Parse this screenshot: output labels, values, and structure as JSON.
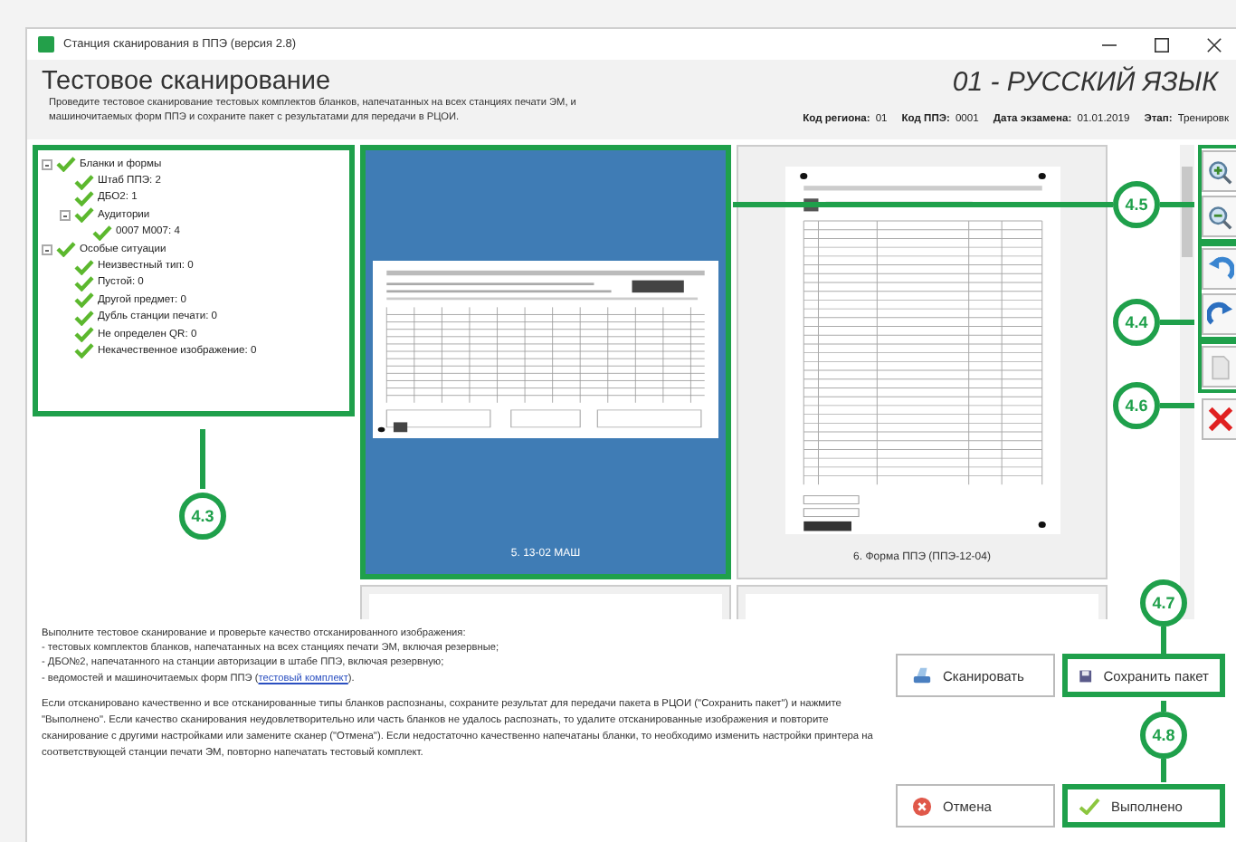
{
  "window": {
    "title": "Станция сканирования в ППЭ (версия 2.8)"
  },
  "header": {
    "title": "Тестовое сканирование",
    "description": "Проведите тестовое сканирование тестовых комплектов бланков, напечатанных на всех станциях печати ЭМ, и машиночитаемых форм ППЭ и сохраните пакет с результатами для передачи в РЦОИ.",
    "subject": "01 - РУССКИЙ ЯЗЫК",
    "fields": [
      {
        "label": "Код региона:",
        "value": "01"
      },
      {
        "label": "Код ППЭ:",
        "value": "0001"
      },
      {
        "label": "Дата экзамена:",
        "value": "01.01.2019"
      },
      {
        "label": "Этап:",
        "value": "Тренировк"
      }
    ]
  },
  "tree": {
    "highlighted": true,
    "items": [
      {
        "label": "Бланки и формы",
        "checked": true,
        "expanded": true,
        "children": [
          {
            "label": "Штаб ППЭ: 2",
            "checked": true
          },
          {
            "label": "ДБО2: 1",
            "checked": true
          },
          {
            "label": "Аудитории",
            "checked": true,
            "expanded": true,
            "children": [
              {
                "label": "0007 М007: 4",
                "checked": true
              }
            ]
          }
        ]
      },
      {
        "label": "Особые ситуации",
        "checked": true,
        "expanded": true,
        "children": [
          {
            "label": "Неизвестный тип: 0",
            "checked": true
          },
          {
            "label": "Пустой: 0",
            "checked": true
          },
          {
            "label": "Другой предмет: 0",
            "checked": true
          },
          {
            "label": "Дубль станции печати: 0",
            "checked": true
          },
          {
            "label": "Не определен QR: 0",
            "checked": true
          },
          {
            "label": "Некачественное изображение: 0",
            "checked": true
          }
        ]
      }
    ]
  },
  "thumbnails": [
    {
      "caption": "5. 13-02 МАШ",
      "selected": true,
      "highlighted": true,
      "kind": "landscape"
    },
    {
      "caption": "6. Форма ППЭ (ППЭ-12-04)",
      "selected": false,
      "highlighted": false,
      "kind": "portrait"
    },
    {
      "selected": false,
      "highlighted": false,
      "kind": "partial"
    },
    {
      "selected": false,
      "highlighted": false,
      "kind": "partial"
    }
  ],
  "toolbar": [
    {
      "highlighted": true,
      "buttons": [
        {
          "kind": "zoom-in"
        },
        {
          "kind": "zoom-out"
        }
      ]
    },
    {
      "highlighted": true,
      "buttons": [
        {
          "kind": "rotate-left"
        },
        {
          "kind": "rotate-right"
        }
      ]
    },
    {
      "highlighted": true,
      "buttons": [
        {
          "kind": "page"
        }
      ]
    },
    {
      "highlighted": false,
      "buttons": [
        {
          "kind": "delete"
        }
      ]
    }
  ],
  "instructions": {
    "lines": [
      "Выполните тестовое сканирование и проверьте качество отсканированного изображения:",
      "- тестовых комплектов бланков, напечатанных на всех станциях печати ЭМ, включая резервные;",
      "- ДБО№2, напечатанного на станции авторизации в штабе ППЭ, включая резервную;"
    ],
    "last_line": {
      "text": "- ведомостей и машиночитаемых форм ППЭ (",
      "link": "тестовый комплект",
      "after": ")."
    },
    "paragraph": "Если отсканировано качественно и все отсканированные типы бланков распознаны, сохраните результат для передачи пакета в РЦОИ (\"Сохранить пакет\") и нажмите \"Выполнено\". Если качество сканирования неудовлетворительно или часть бланков не удалось распознать, то удалите отсканированные изображения и повторите сканирование с другими настройками или замените сканер (\"Отмена\"). Если недостаточно качественно напечатаны бланки, то необходимо изменить настройки принтера на соответствующей станции печати ЭМ, повторно напечатать тестовый комплект."
  },
  "buttons": [
    {
      "label": "Сканировать",
      "kind": "scan",
      "highlighted": false
    },
    {
      "label": "Сохранить пакет",
      "kind": "save",
      "highlighted": true
    },
    {
      "label": "Отмена",
      "kind": "cancel",
      "highlighted": false
    },
    {
      "label": "Выполнено",
      "kind": "done",
      "highlighted": true
    }
  ],
  "callouts": [
    {
      "label": "4.3"
    },
    {
      "label": "4.5"
    },
    {
      "label": "4.4"
    },
    {
      "label": "4.6"
    },
    {
      "label": "4.7"
    },
    {
      "label": "4.8"
    }
  ]
}
